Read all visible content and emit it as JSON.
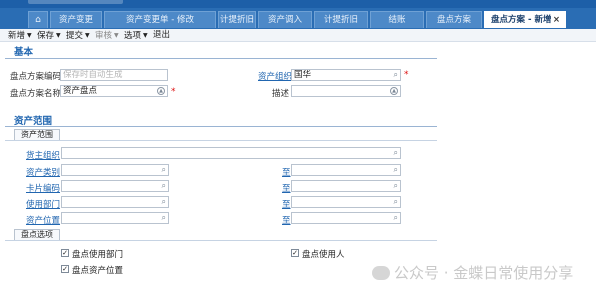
{
  "tabs": [
    {
      "label": "⌂"
    },
    {
      "label": "资产变更"
    },
    {
      "label": "资产变更单 - 修改"
    },
    {
      "label": "计提折旧"
    },
    {
      "label": "资产调入"
    },
    {
      "label": "计提折旧"
    },
    {
      "label": "结账"
    },
    {
      "label": "盘点方案"
    },
    {
      "label": "盘点方案 - 新增",
      "close": "×"
    }
  ],
  "toolbar": {
    "new": "新增",
    "save": "保存",
    "submit": "提交",
    "audit": "审核",
    "options": "选项",
    "exit": "退出"
  },
  "basic": {
    "title": "基本",
    "plan_code_label": "盘点方案编码",
    "plan_code_placeholder": "保存时自动生成",
    "plan_name_label": "盘点方案名称",
    "plan_name_value": "资产盘点",
    "asset_org_label": "资产组织",
    "asset_org_value": "国华",
    "desc_label": "描述",
    "required_mark": "*"
  },
  "scope": {
    "title": "资产范围",
    "subtitle": "资产范围",
    "owner_org": "货主组织",
    "asset_category": "资产类别",
    "card_code": "卡片编码",
    "use_dept": "使用部门",
    "asset_location": "资产位置",
    "to": "至"
  },
  "options": {
    "subtitle": "盘点选项",
    "check_use_dept": "盘点使用部门",
    "check_user": "盘点使用人",
    "check_location": "盘点资产位置",
    "check_mark": "✓"
  },
  "watermark": "公众号 · 金蝶日常使用分享",
  "icons": {
    "search": "magnifier-icon",
    "lookup": "lookup-icon"
  }
}
